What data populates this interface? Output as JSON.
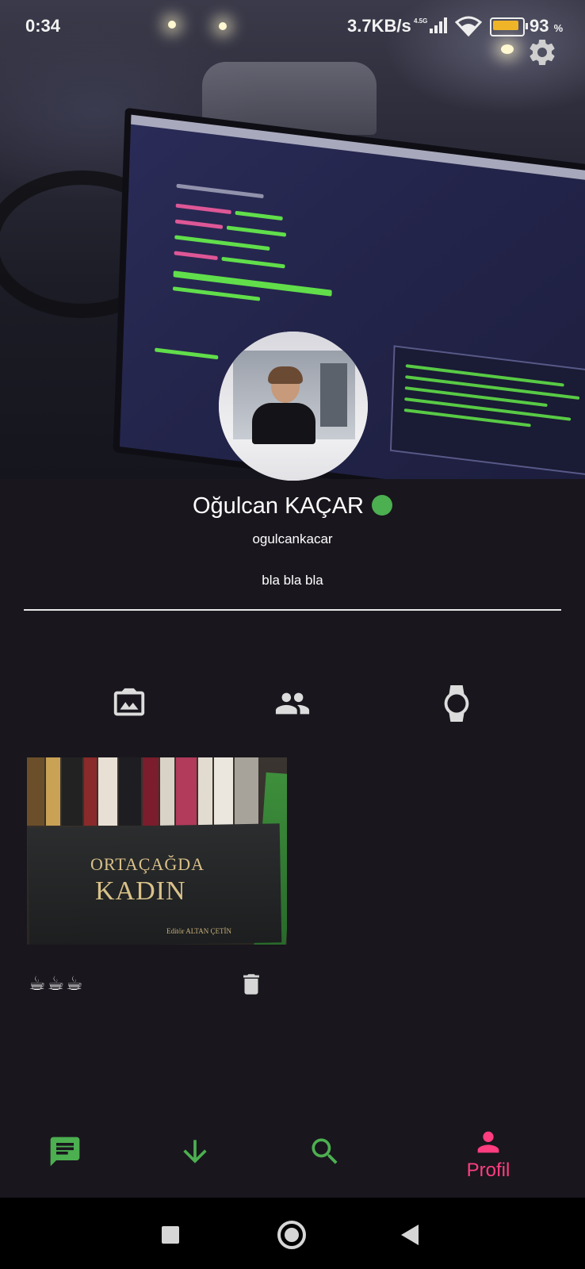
{
  "status_bar": {
    "time": "0:34",
    "network_speed": "3.7KB/s",
    "signal_type": "4.5G",
    "battery_percent": "93",
    "battery_unit": "%"
  },
  "profile": {
    "name": "Oğulcan KAÇAR",
    "username": "ogulcankacar",
    "bio": "bla bla bla",
    "online": true,
    "online_color": "#4caf50"
  },
  "tabs": [
    {
      "icon": "photo-album-icon"
    },
    {
      "icon": "people-icon"
    },
    {
      "icon": "watch-icon"
    }
  ],
  "post": {
    "book_title_line1": "ORTAÇAĞDA",
    "book_title_line2": "KADIN",
    "book_editor": "Editör ALTAN ÇETİN",
    "reactions": "☕☕☕"
  },
  "bottom_nav": {
    "items": [
      {
        "icon": "chat-icon"
      },
      {
        "icon": "arrow-down-icon"
      },
      {
        "icon": "search-icon"
      },
      {
        "icon": "person-icon",
        "label": "Profil"
      }
    ],
    "active_color": "#ff3d7f",
    "inactive_color": "#4caf50"
  }
}
